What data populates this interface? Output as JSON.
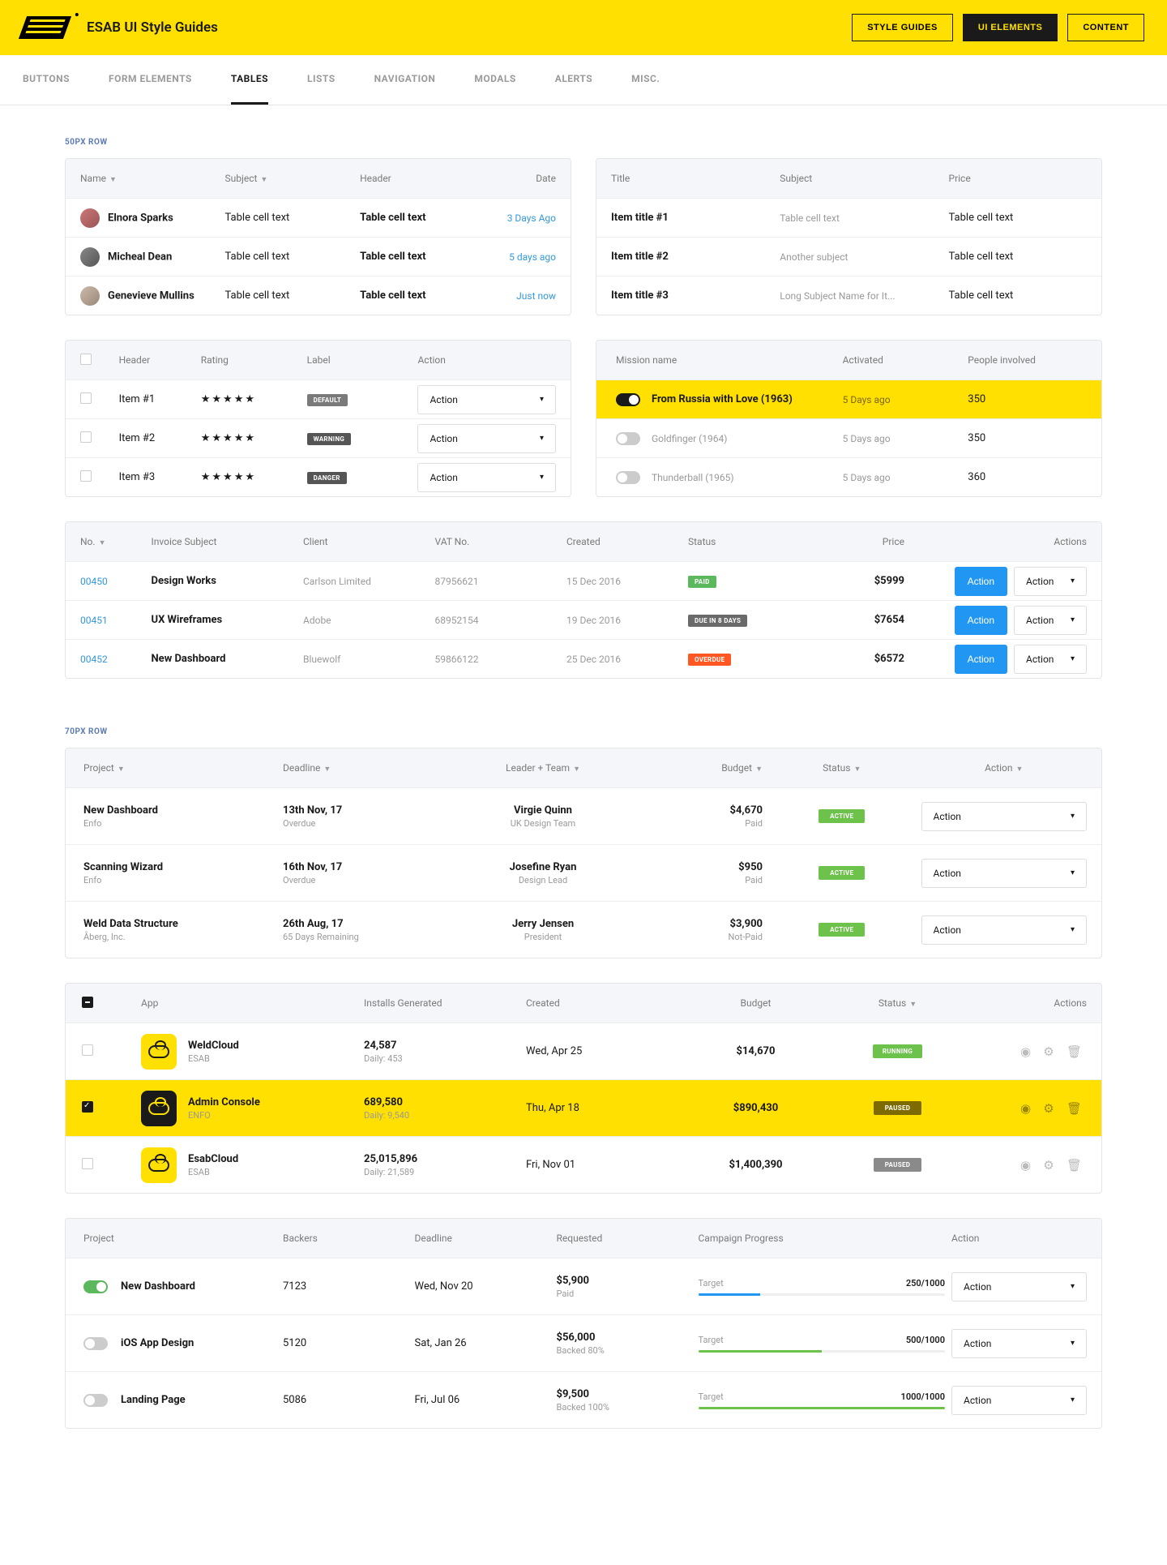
{
  "brand": "ESAB UI Style Guides",
  "topnav": {
    "style_guides": "STYLE GUIDES",
    "ui_elements": "UI ELEMENTS",
    "content": "CONTENT"
  },
  "subnav": [
    "BUTTONS",
    "FORM ELEMENTS",
    "TABLES",
    "LISTS",
    "NAVIGATION",
    "MODALS",
    "ALERTS",
    "MISC."
  ],
  "sec1": "50PX ROW",
  "sec2": "70PX ROW",
  "t1": {
    "h": [
      "Name",
      "Subject",
      "Header",
      "Date"
    ],
    "r": [
      {
        "n": "Elnora Sparks",
        "s": "Table cell text",
        "hd": "Table cell text",
        "d": "3 Days Ago"
      },
      {
        "n": "Micheal Dean",
        "s": "Table cell text",
        "hd": "Table cell text",
        "d": "5 days ago"
      },
      {
        "n": "Genevieve Mullins",
        "s": "Table cell text",
        "hd": "Table cell text",
        "d": "Just now"
      }
    ]
  },
  "t2": {
    "h": [
      "Title",
      "Subject",
      "Price"
    ],
    "r": [
      {
        "t": "Item title #1",
        "s": "Table cell text",
        "p": "Table cell text"
      },
      {
        "t": "Item title #2",
        "s": "Another subject",
        "p": "Table cell text"
      },
      {
        "t": "Item title #3",
        "s": "Long Subject Name for It...",
        "p": "Table cell text"
      }
    ]
  },
  "t3": {
    "h": [
      "Header",
      "Rating",
      "Label",
      "Action"
    ],
    "r": [
      {
        "n": "Item #1",
        "l": "DEFAULT"
      },
      {
        "n": "Item #2",
        "l": "WARNING"
      },
      {
        "n": "Item #3",
        "l": "DANGER"
      }
    ]
  },
  "t4": {
    "h": [
      "Mission name",
      "Activated",
      "People involved"
    ],
    "r": [
      {
        "n": "From Russia with Love (1963)",
        "a": "5 Days ago",
        "p": "350",
        "on": true
      },
      {
        "n": "Goldfinger (1964)",
        "a": "5 Days ago",
        "p": "350",
        "on": false
      },
      {
        "n": "Thunderball (1965)",
        "a": "5 Days ago",
        "p": "360",
        "on": false
      }
    ]
  },
  "t5": {
    "h": [
      "No.",
      "Invoice Subject",
      "Client",
      "VAT No.",
      "Created",
      "Status",
      "Price",
      "Actions"
    ],
    "r": [
      {
        "no": "00450",
        "sub": "Design Works",
        "cl": "Carlson Limited",
        "vat": "87956621",
        "cr": "15 Dec 2016",
        "st": "PAID",
        "pr": "$5999"
      },
      {
        "no": "00451",
        "sub": "UX Wireframes",
        "cl": "Adobe",
        "vat": "68952154",
        "cr": "19 Dec 2016",
        "st": "DUE IN 8 DAYS",
        "pr": "$7654"
      },
      {
        "no": "00452",
        "sub": "New Dashboard",
        "cl": "Bluewolf",
        "vat": "59866122",
        "cr": "25 Dec 2016",
        "st": "OVERDUE",
        "pr": "$6572"
      }
    ]
  },
  "t6": {
    "h": [
      "Project",
      "Deadline",
      "Leader + Team",
      "Budget",
      "Status",
      "Action"
    ],
    "r": [
      {
        "p": "New Dashboard",
        "pc": "Enfo",
        "d": "13th Nov, 17",
        "ds": "Overdue",
        "l": "Virgie Quinn",
        "lt": "UK Design Team",
        "b": "$4,670",
        "bs": "Paid",
        "st": "ACTIVE"
      },
      {
        "p": "Scanning Wizard",
        "pc": "Enfo",
        "d": "16th Nov, 17",
        "ds": "Overdue",
        "l": "Josefine Ryan",
        "lt": "Design Lead",
        "b": "$950",
        "bs": "Paid",
        "st": "ACTIVE"
      },
      {
        "p": "Weld Data Structure",
        "pc": "Åberg, Inc.",
        "d": "26th Aug, 17",
        "ds": "65 Days Remaining",
        "l": "Jerry Jensen",
        "lt": "President",
        "b": "$3,900",
        "bs": "Not-Paid",
        "st": "ACTIVE"
      }
    ]
  },
  "t7": {
    "h": [
      "App",
      "Installs Generated",
      "Created",
      "Budget",
      "Status",
      "Actions"
    ],
    "r": [
      {
        "a": "WeldCloud",
        "ac": "ESAB",
        "i": "24,587",
        "is": "Daily: 453",
        "c": "Wed, Apr 25",
        "b": "$14,670",
        "st": "RUNNING",
        "sel": false
      },
      {
        "a": "Admin Console",
        "ac": "ENFO",
        "i": "689,580",
        "is": "Daily: 9,540",
        "c": "Thu, Apr 18",
        "b": "$890,430",
        "st": "PAUSED",
        "sel": true
      },
      {
        "a": "EsabCloud",
        "ac": "ESAB",
        "i": "25,015,896",
        "is": "Daily: 21,589",
        "c": "Fri, Nov 01",
        "b": "$1,400,390",
        "st": "PAUSED",
        "sel": false
      }
    ]
  },
  "t8": {
    "h": [
      "Project",
      "Backers",
      "Deadline",
      "Requested",
      "Campaign Progress",
      "Action"
    ],
    "r": [
      {
        "p": "New Dashboard",
        "b": "7123",
        "d": "Wed, Nov 20",
        "r": "$5,900",
        "rs": "Paid",
        "pl": "Target",
        "pv": "250/1000",
        "pct": 25,
        "on": true
      },
      {
        "p": "iOS App Design",
        "b": "5120",
        "d": "Sat, Jan 26",
        "r": "$56,000",
        "rs": "Backed 80%",
        "pl": "Target",
        "pv": "500/1000",
        "pct": 50,
        "on": false
      },
      {
        "p": "Landing Page",
        "b": "5086",
        "d": "Fri, Jul 06",
        "r": "$9,500",
        "rs": "Backed 100%",
        "pl": "Target",
        "pv": "1000/1000",
        "pct": 100,
        "on": false
      }
    ]
  },
  "action": "Action",
  "stars": "★★★★★"
}
